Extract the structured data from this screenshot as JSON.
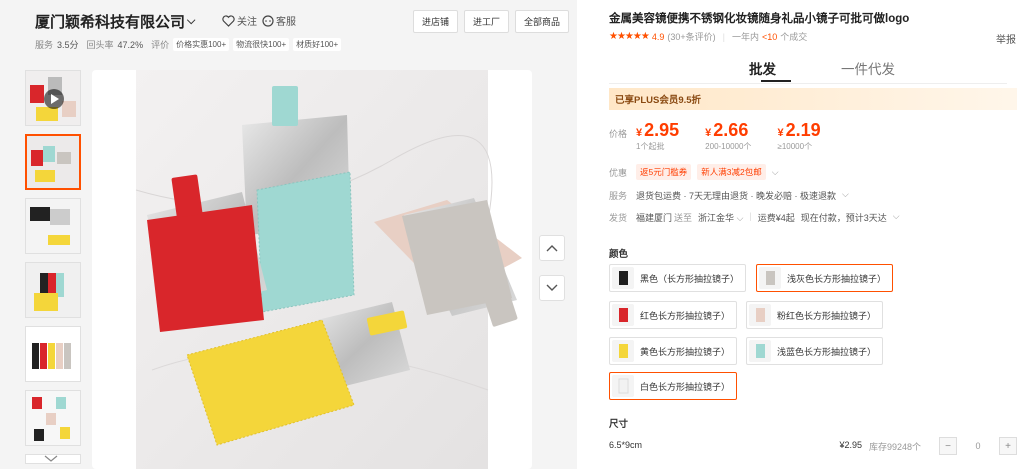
{
  "shop": {
    "name": "厦门颖希科技有限公司",
    "follow_label": "关注",
    "service_label": "客服",
    "buttons": [
      "进店铺",
      "进工厂",
      "全部商品"
    ],
    "stats": {
      "service_label": "服务",
      "service_value": "3.5分",
      "repeat_label": "回头率",
      "repeat_value": "47.2%",
      "review_label": "评价",
      "tags": [
        "价格实惠100+",
        "物流很快100+",
        "材质好100+"
      ]
    }
  },
  "gallery": {
    "thumb_count": 7,
    "up_icon": "chevron-up-icon",
    "down_icon": "chevron-down-icon"
  },
  "product": {
    "title": "金属美容镜便携不锈钢化妆镜随身礼品小镜子可批可做logo",
    "rating_score": "4.9",
    "rating_count": "(30+条评价)",
    "sales": "一年内<10 个成交",
    "sales_prefix": "一年内",
    "sales_hl": "<10",
    "sales_suffix": "个成交",
    "report": "举报",
    "tabs": [
      "批发",
      "一件代发"
    ],
    "plus_banner": "已享PLUS会员9.5折",
    "price_label": "价格",
    "prices": [
      {
        "amount": "2.95",
        "qty": "1个起批"
      },
      {
        "amount": "2.66",
        "qty": "200-10000个"
      },
      {
        "amount": "2.19",
        "qty": "≥10000个"
      }
    ],
    "currency": "¥",
    "promo_label": "优惠",
    "promos": [
      "返5元门槛券",
      "新人满3减2包邮"
    ],
    "service_label": "服务",
    "services": "退货包运费 · 7天无理由退货 · 晚发必赔 · 极速退款",
    "ship_label": "发货",
    "ship_from": "福建厦门",
    "ship_to_word": "送至",
    "ship_to": "浙江金华",
    "ship_fee": "运费¥4起",
    "ship_time": "现在付款，预计3天达",
    "color_label": "颜色",
    "colors": [
      {
        "label": "黑色（长方形抽拉镜子）",
        "color": "#1e1e1e",
        "selected": false
      },
      {
        "label": "浅灰色长方形抽拉镜子）",
        "color": "#c9c5c0",
        "selected": true
      },
      {
        "label": "红色长方形抽拉镜子）",
        "color": "#d9262b",
        "selected": false
      },
      {
        "label": "粉红色长方形抽拉镜子）",
        "color": "#e8cfc4",
        "selected": false
      },
      {
        "label": "黄色长方形抽拉镜子）",
        "color": "#f4d63a",
        "selected": false
      },
      {
        "label": "浅蓝色长方形抽拉镜子）",
        "color": "#9fd8d2",
        "selected": false
      },
      {
        "label": "白色长方形抽拉镜子）",
        "color": "#f2f2f2",
        "selected": true
      }
    ],
    "size_label": "尺寸",
    "size": {
      "name": "6.5*9cm",
      "price": "¥2.95",
      "stock": "库存99248个",
      "quantity": "0",
      "minus": "−",
      "plus": "+"
    }
  }
}
